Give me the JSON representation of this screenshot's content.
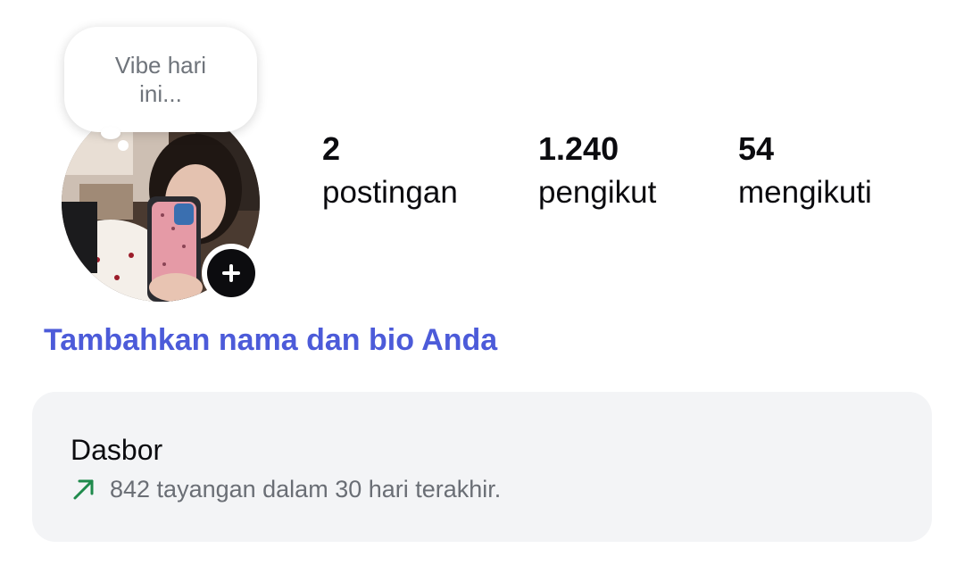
{
  "profile": {
    "note_text": "Vibe hari ini...",
    "add_bio_link": "Tambahkan nama dan bio Anda"
  },
  "stats": {
    "posts": {
      "count": "2",
      "label": "postingan"
    },
    "followers": {
      "count": "1.240",
      "label": "pengikut"
    },
    "following": {
      "count": "54",
      "label": "mengikuti"
    }
  },
  "dashboard": {
    "title": "Dasbor",
    "stat_text": "842 tayangan dalam 30 hari terakhir.",
    "trend_icon": "arrow-up-right-icon"
  },
  "colors": {
    "link": "#4c5bd9",
    "trend": "#1f8a4c",
    "card_background": "#f3f4f6",
    "muted_text": "#6a6e75"
  }
}
